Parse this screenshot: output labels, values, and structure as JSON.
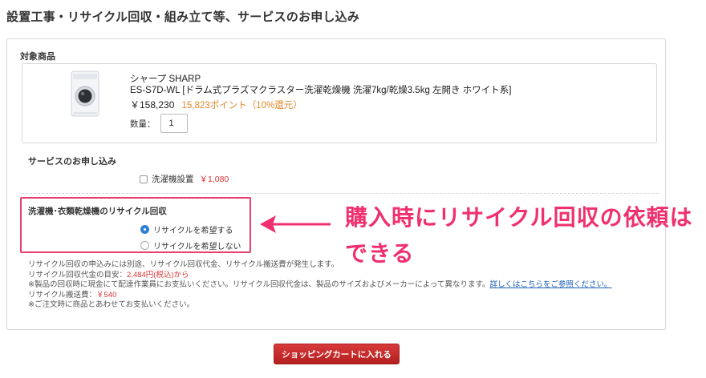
{
  "page": {
    "title": "設置工事・リサイクル回収・組み立て等、サービスのお申し込み"
  },
  "product_section": {
    "label": "対象商品",
    "brand": "シャープ SHARP",
    "name": "ES-S7D-WL [ドラム式プラズマクラスター洗濯乾燥機 洗濯7kg/乾燥3.5kg 左開き ホワイト系]",
    "price": "￥158,230",
    "points": "15,823ポイント（10%還元）",
    "quantity_label": "数量：",
    "quantity_value": "1"
  },
  "service_section": {
    "label": "サービスのお申し込み",
    "install_label": "洗濯機設置",
    "install_price": "￥1,080",
    "install_checked": false
  },
  "recycle_section": {
    "title": "洗濯機･衣類乾燥機のリサイクル回収",
    "options": [
      {
        "label": "リサイクルを希望する",
        "selected": true
      },
      {
        "label": "リサイクルを希望しない",
        "selected": false
      }
    ]
  },
  "notes": {
    "line1": "リサイクル回収の申込みには別途、リサイクル回収代金、リサイクル搬送費が発生します。",
    "line2_prefix": "リサイクル回収代金の目安：",
    "line2_value": "2,484円(税込)から",
    "line3_text": "※製品の回収時に現金にて配達作業員にお支払いください。リサイクル回収代金は、製品のサイズおよびメーカーによって異なります。",
    "line3_link": "詳しくはこちらをご参照ください。",
    "line4_prefix": "リサイクル搬送費：",
    "line4_value": "￥540",
    "line5": "※ご注文時に商品とあわせてお支払いください。"
  },
  "cart_button": {
    "label": "ショッピングカートに入れる"
  },
  "annotation": {
    "line1": "購入時にリサイクル回収の依頼は",
    "line2": "できる",
    "color": "#f0306e"
  },
  "colors": {
    "accent_red": "#d33333",
    "points_orange": "#e2892a",
    "highlight_pink": "#e6406e",
    "radio_blue": "#2f7fd8"
  }
}
